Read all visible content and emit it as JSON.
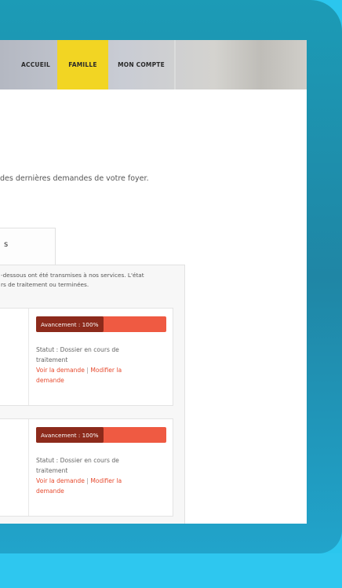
{
  "nav": {
    "items": [
      {
        "label": "ACCUEIL"
      },
      {
        "label": "FAMILLE"
      },
      {
        "label": "MON COMPTE"
      }
    ],
    "active_color": "#f2d523"
  },
  "intro_text": "des dernières demandes de votre foyer.",
  "tab": {
    "label": "s"
  },
  "panel": {
    "text_line1": "-dessous ont été transmises à nos services. L'état",
    "text_line2": "rs de traitement ou terminées."
  },
  "requests": [
    {
      "progress_label": "Avancement : 100%",
      "progress": 1.0,
      "status_line1": "Statut : Dossier en cours de",
      "status_line2": "traitement",
      "view_link": "Voir la demande",
      "separator": "|",
      "edit_link_1": "Modifier la",
      "edit_link_2": "demande"
    },
    {
      "progress_label": "Avancement : 100%",
      "progress": 1.0,
      "status_line1": "Statut : Dossier en cours de",
      "status_line2": "traitement",
      "view_link": "Voir la demande",
      "separator": "|",
      "edit_link_1": "Modifier la",
      "edit_link_2": "demande"
    }
  ],
  "colors": {
    "progress_bar": "#ef5a42",
    "progress_label_bg": "#8c2a1b",
    "link": "#e64a2e",
    "frame": "#2089a9",
    "background": "#2bc6ee"
  }
}
